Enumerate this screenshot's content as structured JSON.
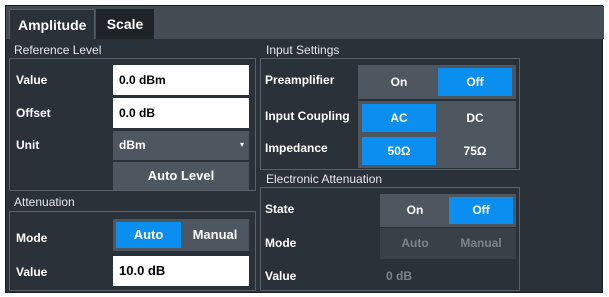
{
  "tabs": {
    "amplitude": "Amplitude",
    "scale": "Scale"
  },
  "reference_level": {
    "title": "Reference Level",
    "value_label": "Value",
    "value": "0.0 dBm",
    "offset_label": "Offset",
    "offset": "0.0 dB",
    "unit_label": "Unit",
    "unit": "dBm",
    "auto_level": "Auto Level"
  },
  "attenuation": {
    "title": "Attenuation",
    "mode_label": "Mode",
    "mode_auto": "Auto",
    "mode_manual": "Manual",
    "selected_mode": "Auto",
    "value_label": "Value",
    "value": "10.0 dB"
  },
  "input_settings": {
    "title": "Input Settings",
    "preamplifier_label": "Preamplifier",
    "preamp_on": "On",
    "preamp_off": "Off",
    "preamp_selected": "Off",
    "coupling_label": "Input Coupling",
    "coupling_ac": "AC",
    "coupling_dc": "DC",
    "coupling_selected": "AC",
    "impedance_label": "Impedance",
    "impedance_50": "50Ω",
    "impedance_75": "75Ω",
    "impedance_selected": "50Ω"
  },
  "electronic_attenuation": {
    "title": "Electronic Attenuation",
    "state_label": "State",
    "state_on": "On",
    "state_off": "Off",
    "state_selected": "Off",
    "mode_label": "Mode",
    "mode_auto": "Auto",
    "mode_manual": "Manual",
    "value_label": "Value",
    "value": "0 dB"
  },
  "colors": {
    "background": "#2b3138",
    "accent": "#0a8ff0",
    "button": "#4e5660",
    "disabled": "#3a4048"
  }
}
